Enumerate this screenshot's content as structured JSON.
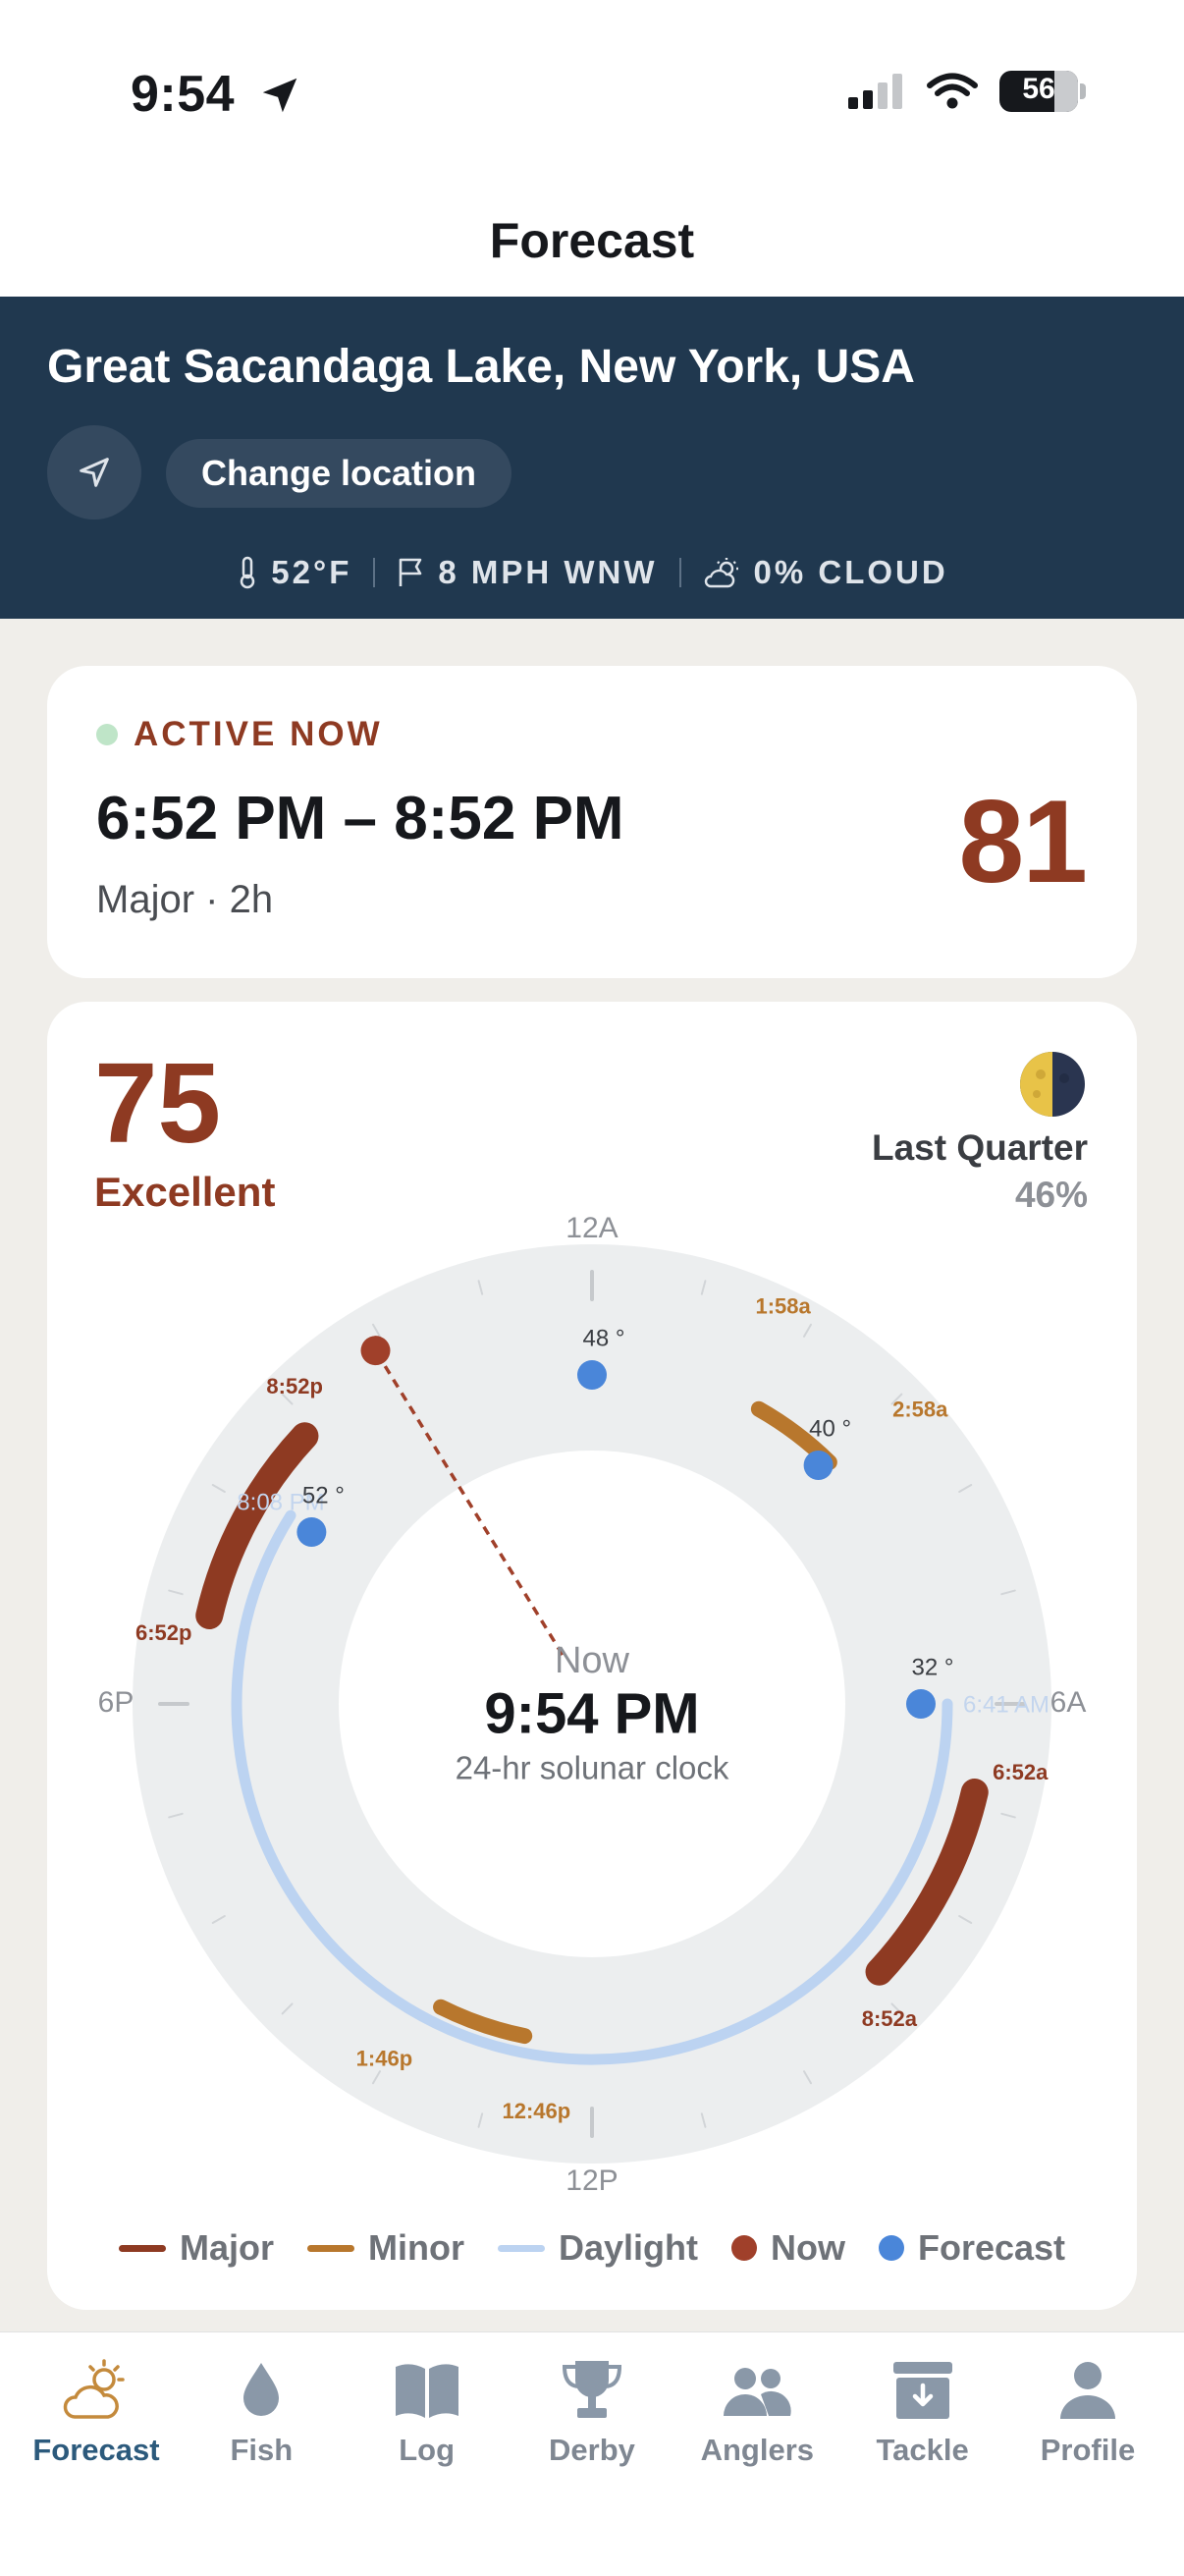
{
  "status_bar": {
    "time": "9:54",
    "battery": "56"
  },
  "nav": {
    "title": "Forecast"
  },
  "location": {
    "name": "Great Sacandaga Lake, New York, USA",
    "change_label": "Change location"
  },
  "weather": {
    "temp": "52°F",
    "wind": "8 MPH WNW",
    "cloud": "0% CLOUD"
  },
  "active": {
    "label": "ACTIVE NOW",
    "time_range": "6:52 PM – 8:52 PM",
    "detail": "Major · 2h",
    "score": "81"
  },
  "day": {
    "score": "75",
    "rating": "Excellent"
  },
  "moon": {
    "phase": "Last Quarter",
    "illumination": "46%",
    "illumination_value": 0.46
  },
  "clock": {
    "center_label": "Now",
    "center_time": "9:54 PM",
    "caption": "24-hr solunar clock",
    "now_hours": 21.9,
    "axis_labels": {
      "top": "12A",
      "right": "6A",
      "bottom": "12P",
      "left": "6P"
    },
    "periods": [
      {
        "kind": "major",
        "start": 18.8667,
        "end": 20.8667,
        "start_label": "6:52p",
        "end_label": "8:52p"
      },
      {
        "kind": "minor",
        "start": 1.9667,
        "end": 2.9667,
        "start_label": "1:58a",
        "end_label": "2:58a"
      },
      {
        "kind": "major",
        "start": 6.8667,
        "end": 8.8667,
        "start_label": "6:52a",
        "end_label": "8:52a"
      },
      {
        "kind": "minor",
        "start": 12.7667,
        "end": 13.7667,
        "start_label": "12:46p",
        "end_label": "1:46p"
      }
    ],
    "daylight": {
      "start": 6.0,
      "end": 20.1333,
      "sunrise_label": "6:41 AM",
      "sunset_label": "8:08 PM"
    },
    "forecast": [
      {
        "hour": 0.0,
        "temp": "48 °"
      },
      {
        "hour": 2.9,
        "temp": "40 °"
      },
      {
        "hour": 6.0,
        "temp": "32 °"
      },
      {
        "hour": 20.1,
        "temp": "52 °"
      }
    ],
    "colors": {
      "major": "#8e3a22",
      "minor": "#b8772d",
      "daylight": "#bcd3f1",
      "forecast": "#4a86d9",
      "now": "#a0402a"
    }
  },
  "legend": [
    "Major",
    "Minor",
    "Daylight",
    "Now",
    "Forecast"
  ],
  "tabs": [
    {
      "label": "Forecast",
      "icon": "sun-cloud-icon",
      "active": true
    },
    {
      "label": "Fish",
      "icon": "droplet-icon"
    },
    {
      "label": "Log",
      "icon": "book-icon"
    },
    {
      "label": "Derby",
      "icon": "trophy-icon"
    },
    {
      "label": "Anglers",
      "icon": "people-icon"
    },
    {
      "label": "Tackle",
      "icon": "tackle-box-icon"
    },
    {
      "label": "Profile",
      "icon": "person-icon"
    }
  ]
}
